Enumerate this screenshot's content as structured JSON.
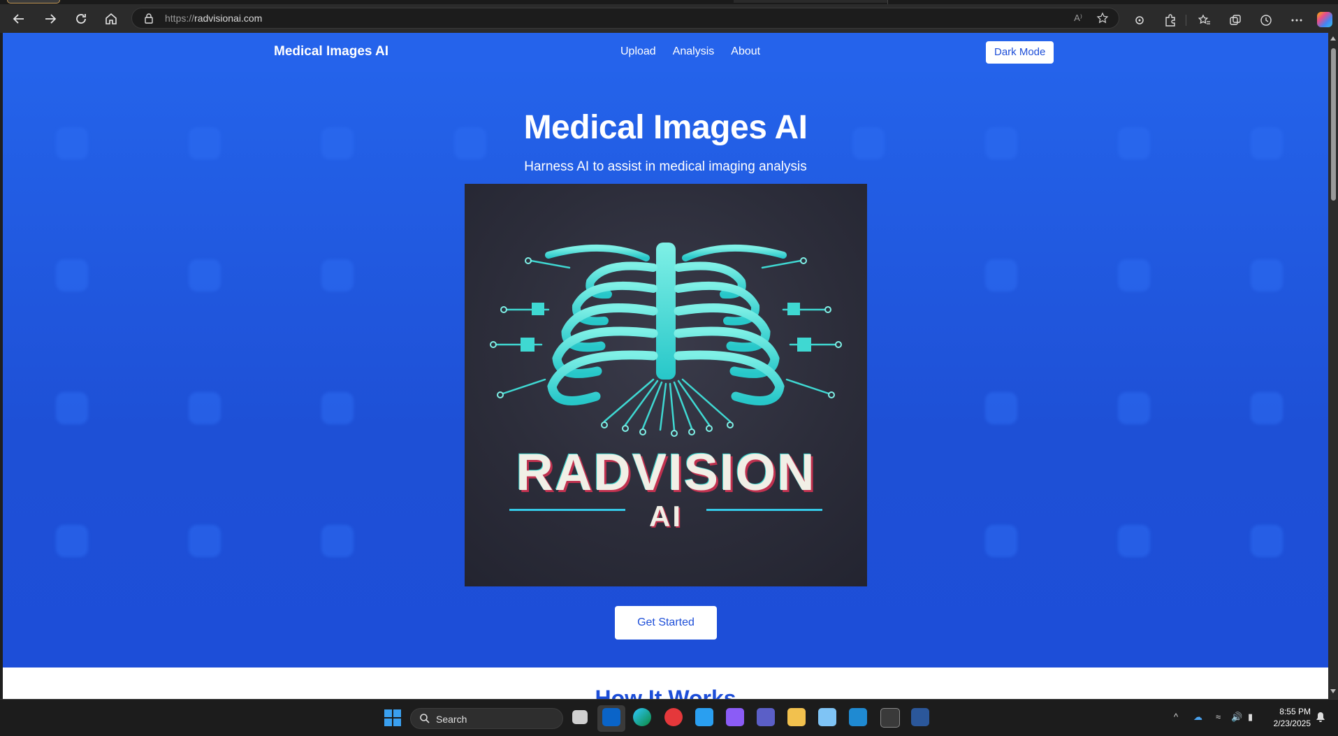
{
  "browser": {
    "url_scheme": "https://",
    "url_host": "radvisionai.com",
    "read_aloud_label": "A⁾"
  },
  "site": {
    "brand": "Medical Images AI",
    "nav": [
      "Upload",
      "Analysis",
      "About"
    ],
    "dark_mode_label": "Dark Mode"
  },
  "hero": {
    "title": "Medical Images AI",
    "subtitle": "Harness AI to assist in medical imaging analysis",
    "logo_word": "RADVISION",
    "logo_sub": "AI",
    "cta_label": "Get Started",
    "scroll_top_label": "↑"
  },
  "next_section": {
    "title": "How It Works"
  },
  "taskbar": {
    "search_label": "Search",
    "time": "8:55 PM",
    "date": "2/23/2025"
  },
  "colors": {
    "nav_bg": "#2563eb",
    "hero_bg": "#1e50d6",
    "logo_accent": "#35d1c9"
  }
}
